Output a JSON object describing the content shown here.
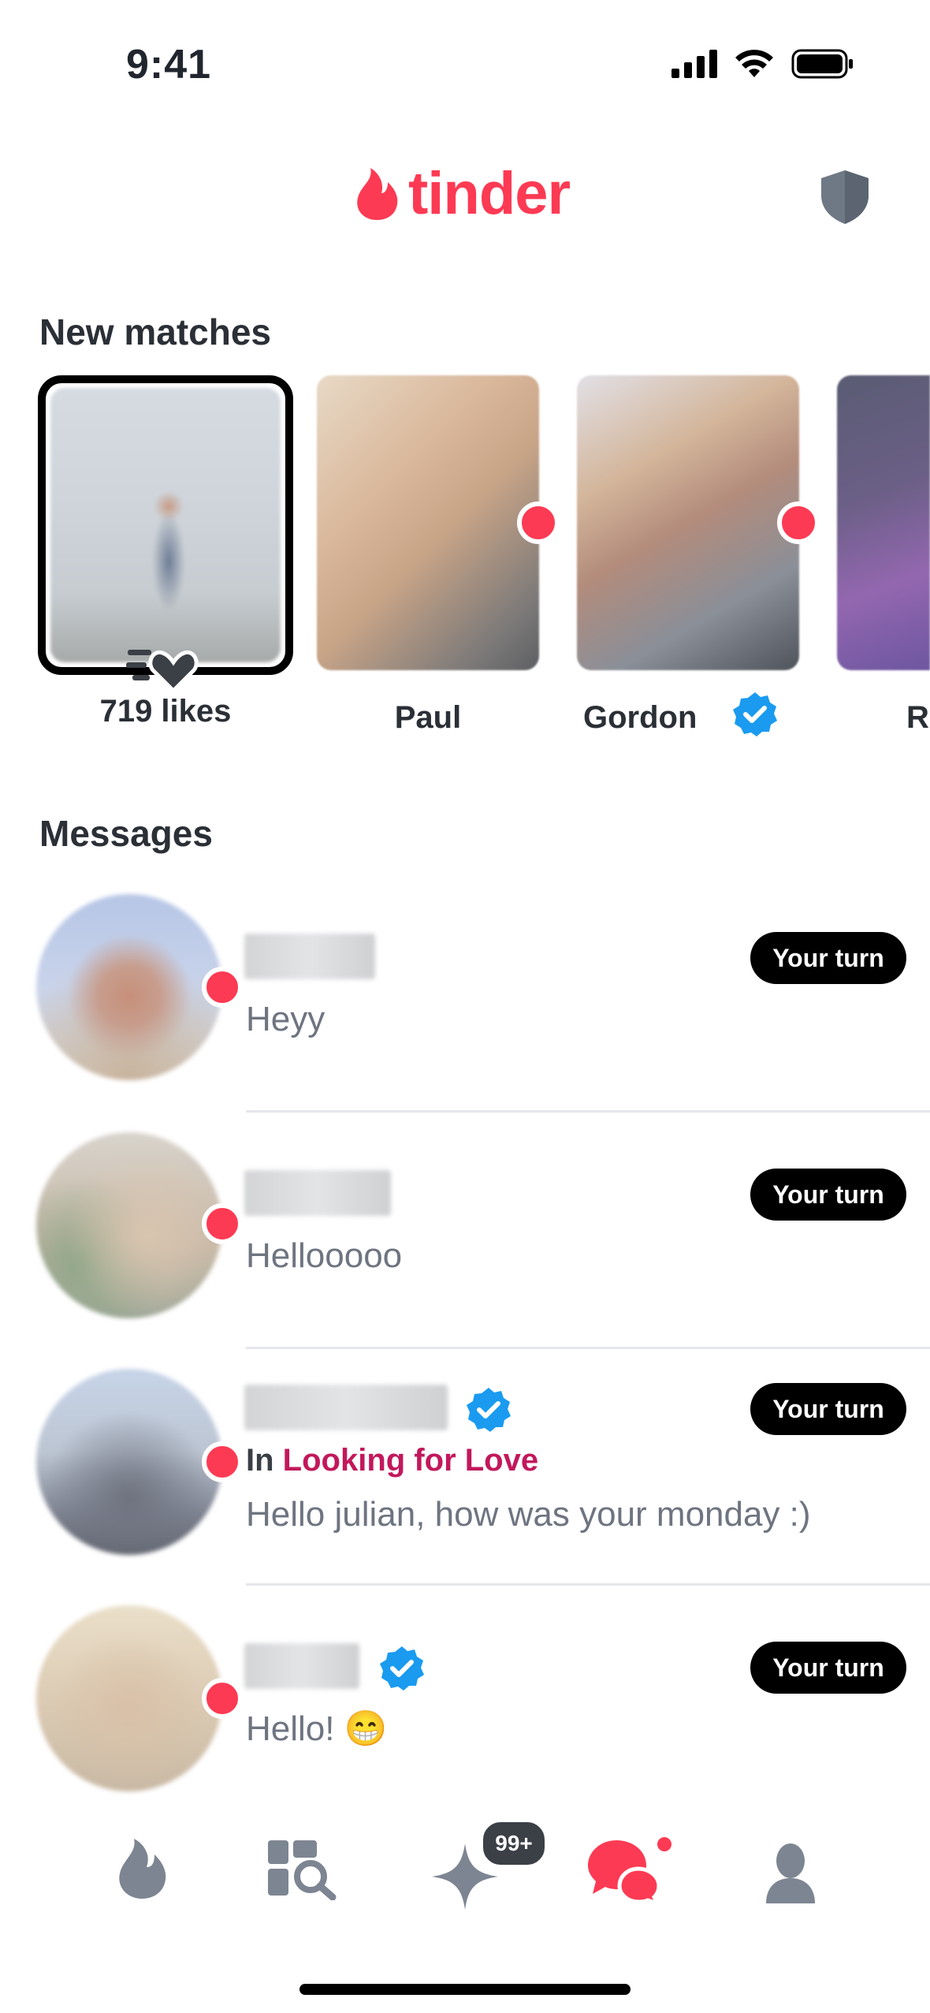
{
  "status_bar": {
    "time": "9:41"
  },
  "header": {
    "logo_text": "tinder",
    "brand_color": "#fd3a53"
  },
  "new_matches": {
    "title": "New matches",
    "likes_label": "719 likes",
    "matches": [
      {
        "name": "Paul",
        "verified": false,
        "new": true
      },
      {
        "name": "Gordon",
        "verified": true,
        "new": true
      },
      {
        "name": "R",
        "verified": false,
        "new": false
      }
    ]
  },
  "messages": {
    "title": "Messages",
    "items": [
      {
        "preview": "Heyy",
        "badge": "Your turn",
        "verified": false
      },
      {
        "preview": "Hellooooo",
        "badge": "Your turn",
        "verified": false
      },
      {
        "group_prefix": "In",
        "group_name": "Looking for Love",
        "preview": "Hello julian, how was your monday :)",
        "badge": "Your turn",
        "verified": true
      },
      {
        "preview": "Hello! 😁",
        "badge": "Your turn",
        "verified": true
      }
    ]
  },
  "tab_bar": {
    "tabs": [
      "flame-icon",
      "explore-icon",
      "sparkle-icon",
      "chat-icon",
      "profile-icon"
    ],
    "active": "chat-icon",
    "sparkle_badge": "99+"
  },
  "colors": {
    "verified_blue": "#1a9bf0",
    "inactive_icon": "#7d8592",
    "group_pink": "#c2185b"
  }
}
